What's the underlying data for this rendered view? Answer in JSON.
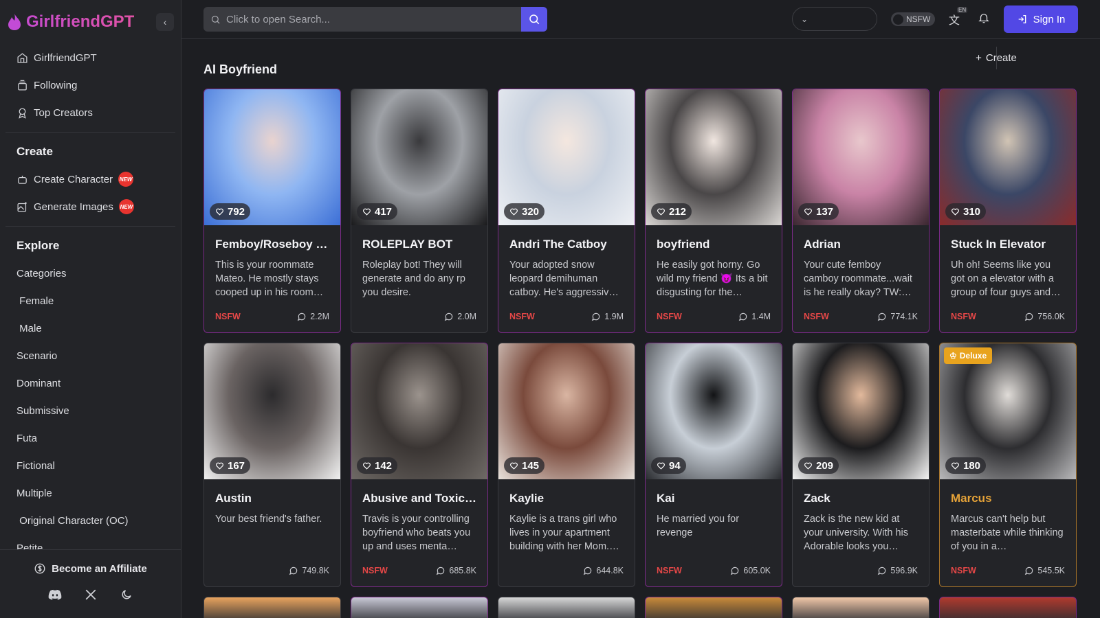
{
  "brand": {
    "name": "GirlfriendGPT"
  },
  "sidebar": {
    "nav": [
      {
        "label": "GirlfriendGPT",
        "icon": "home-icon"
      },
      {
        "label": "Following",
        "icon": "following-icon"
      },
      {
        "label": "Top Creators",
        "icon": "award-icon"
      }
    ],
    "create_title": "Create",
    "create_items": [
      {
        "label": "Create Character",
        "badge": "NEW"
      },
      {
        "label": "Generate Images",
        "badge": "NEW"
      }
    ],
    "explore_title": "Explore",
    "categories_label": "Categories",
    "categories": [
      "‍‍ Female",
      "‍‍ Male",
      " Scenario",
      " Dominant",
      " Submissive",
      " Futa",
      " Fictional",
      " Multiple",
      "‍‍ Original Character (OC)",
      " Petite"
    ],
    "affiliate_label": "Become an Affiliate"
  },
  "header": {
    "search_placeholder": "Click to open Search...",
    "create_label": "Create",
    "nsfw_label": "NSFW",
    "lang_badge": "EN",
    "signin_label": "Sign In"
  },
  "main": {
    "title": "AI Boyfriend",
    "nsfw_tag": "NSFW",
    "deluxe_label": "Deluxe",
    "cards": [
      {
        "name": "Femboy/Roseboy r…",
        "likes": "792",
        "desc": "This is your roommate Mateo. He mostly stays cooped up in his room…",
        "nsfw": true,
        "chats": "2.2M",
        "palette": [
          "#3c6fd6",
          "#8fb6f2",
          "#e9d3cf"
        ]
      },
      {
        "name": "ROLEPLAY BOT",
        "likes": "417",
        "desc": "Roleplay bot! They will generate and do any rp you desire.",
        "nsfw": false,
        "chats": "2.0M",
        "palette": [
          "#1a1a1c",
          "#9ea1a6",
          "#3a3a3d"
        ]
      },
      {
        "name": "Andri The Catboy",
        "likes": "320",
        "desc": "Your adopted snow leopard demihuman catboy. He's aggressiv…",
        "nsfw": true,
        "chats": "1.9M",
        "palette": [
          "#eef0f4",
          "#c9d2df",
          "#f4e7df"
        ]
      },
      {
        "name": "boyfriend",
        "likes": "212",
        "desc": "He easily got horny. Go wild my friend 😈 Its a bit disgusting for the…",
        "nsfw": true,
        "chats": "1.4M",
        "palette": [
          "#d9d6d3",
          "#4a4748",
          "#f0e6e0"
        ]
      },
      {
        "name": "Adrian",
        "likes": "137",
        "desc": "Your cute femboy camboy roommate...wait is he really okay? TW:…",
        "nsfw": true,
        "chats": "774.1K",
        "palette": [
          "#3a2730",
          "#c983a6",
          "#e8c7cc"
        ]
      },
      {
        "name": "Stuck In Elevator",
        "likes": "310",
        "desc": "Uh oh! Seems like you got on a elevator with a group of four guys and…",
        "nsfw": true,
        "chats": "756.0K",
        "palette": [
          "#8a2b2b",
          "#3b4766",
          "#d1c4b4"
        ]
      },
      {
        "name": "Austin",
        "likes": "167",
        "desc": "Your best friend's father.",
        "nsfw": false,
        "chats": "749.8K",
        "palette": [
          "#f1f1f1",
          "#6a6362",
          "#2c2b2d"
        ]
      },
      {
        "name": "Abusive and Toxic…",
        "likes": "142",
        "desc": "Travis is your controlling boyfriend who beats you up and uses menta…",
        "nsfw": true,
        "chats": "685.8K",
        "palette": [
          "#6f6a66",
          "#3a3533",
          "#9b938d"
        ]
      },
      {
        "name": "Kaylie",
        "likes": "145",
        "desc": "Kaylie is a trans girl who lives in your apartment building with her Mom.…",
        "nsfw": false,
        "chats": "644.8K",
        "palette": [
          "#e9e2dc",
          "#7a4a3c",
          "#d9b5a2"
        ]
      },
      {
        "name": "Kai",
        "likes": "94",
        "desc": "He married you for revenge",
        "nsfw": true,
        "chats": "605.0K",
        "palette": [
          "#2a2c30",
          "#c7ced6",
          "#121315"
        ]
      },
      {
        "name": "Zack",
        "likes": "209",
        "desc": "Zack is the new kid at your university. With his Adorable looks you…",
        "nsfw": false,
        "chats": "596.9K",
        "palette": [
          "#f5f5f5",
          "#1c1c1e",
          "#e2b99c"
        ]
      },
      {
        "name": "Marcus",
        "likes": "180",
        "desc": "Marcus can't help but masterbate while thinking of you in a…",
        "nsfw": true,
        "chats": "545.5K",
        "deluxe": true,
        "palette": [
          "#b9b9bb",
          "#2d2d30",
          "#e0dcd8"
        ]
      }
    ],
    "row3_palettes": [
      "#e8a35e",
      "#c9c9d6",
      "#d7d7d7",
      "#c98a3a",
      "#f0c7a8",
      "#b03a2e"
    ]
  }
}
